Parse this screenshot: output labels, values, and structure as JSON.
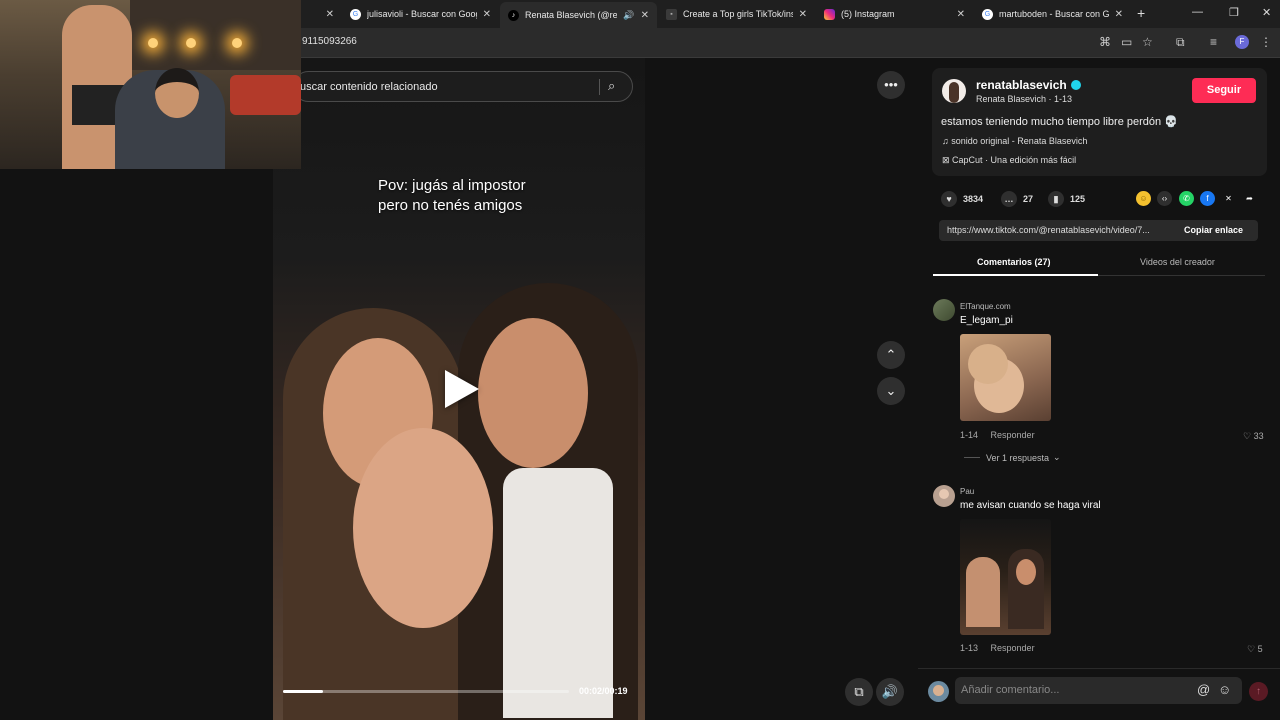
{
  "browser": {
    "tabs": [
      {
        "title": "",
        "favicon": "none",
        "active": false
      },
      {
        "title": "julisavioli - Buscar con Google",
        "favicon": "google-icon",
        "active": false
      },
      {
        "title": "Renata Blasevich (@renata",
        "favicon": "tiktok-icon",
        "active": true
      },
      {
        "title": "Create a Top girls TikTok/insta",
        "favicon": "generic-icon",
        "active": false
      },
      {
        "title": "(5) Instagram",
        "favicon": "instagram-icon",
        "active": false
      },
      {
        "title": "martuboden - Buscar con Goog",
        "favicon": "google-icon",
        "active": false
      }
    ],
    "new_tab": "+",
    "url_fragment": "9115093266",
    "profile_initial": "F"
  },
  "video": {
    "search_placeholder": "uscar contenido relacionado",
    "caption_line1": "Pov: jugás al impostor",
    "caption_line2": "pero no tenés amigos",
    "time": "00:02/00:19",
    "progress": 0.14
  },
  "post": {
    "username": "renatablasevich",
    "subtitle": "Renata Blasevich · 1-13",
    "follow_label": "Seguir",
    "description": "estamos teniendo mucho tiempo libre perdón 💀",
    "sound": "sonido original - Renata Blasevich",
    "capcut": "CapCut · Una edición más fácil",
    "likes": "3834",
    "comments_count": "27",
    "saves": "125",
    "link": "https://www.tiktok.com/@renatablasevich/video/7...",
    "copy_label": "Copiar enlace"
  },
  "tabs": {
    "comments": "Comentarios (27)",
    "creator": "Videos del creador"
  },
  "comments": [
    {
      "author": "ElTanque.com",
      "text": "E_legam_pi",
      "date": "1-14",
      "reply": "Responder",
      "likes": "33",
      "replies": "Ver 1 respuesta"
    },
    {
      "author": "Pau",
      "text": "me avisan cuando se haga viral",
      "date": "1-13",
      "reply": "Responder",
      "likes": "5"
    }
  ],
  "comment_box": {
    "placeholder": "Añadir comentario..."
  },
  "colors": {
    "follow": "#fe2c55",
    "verified": "#20d5ec"
  }
}
